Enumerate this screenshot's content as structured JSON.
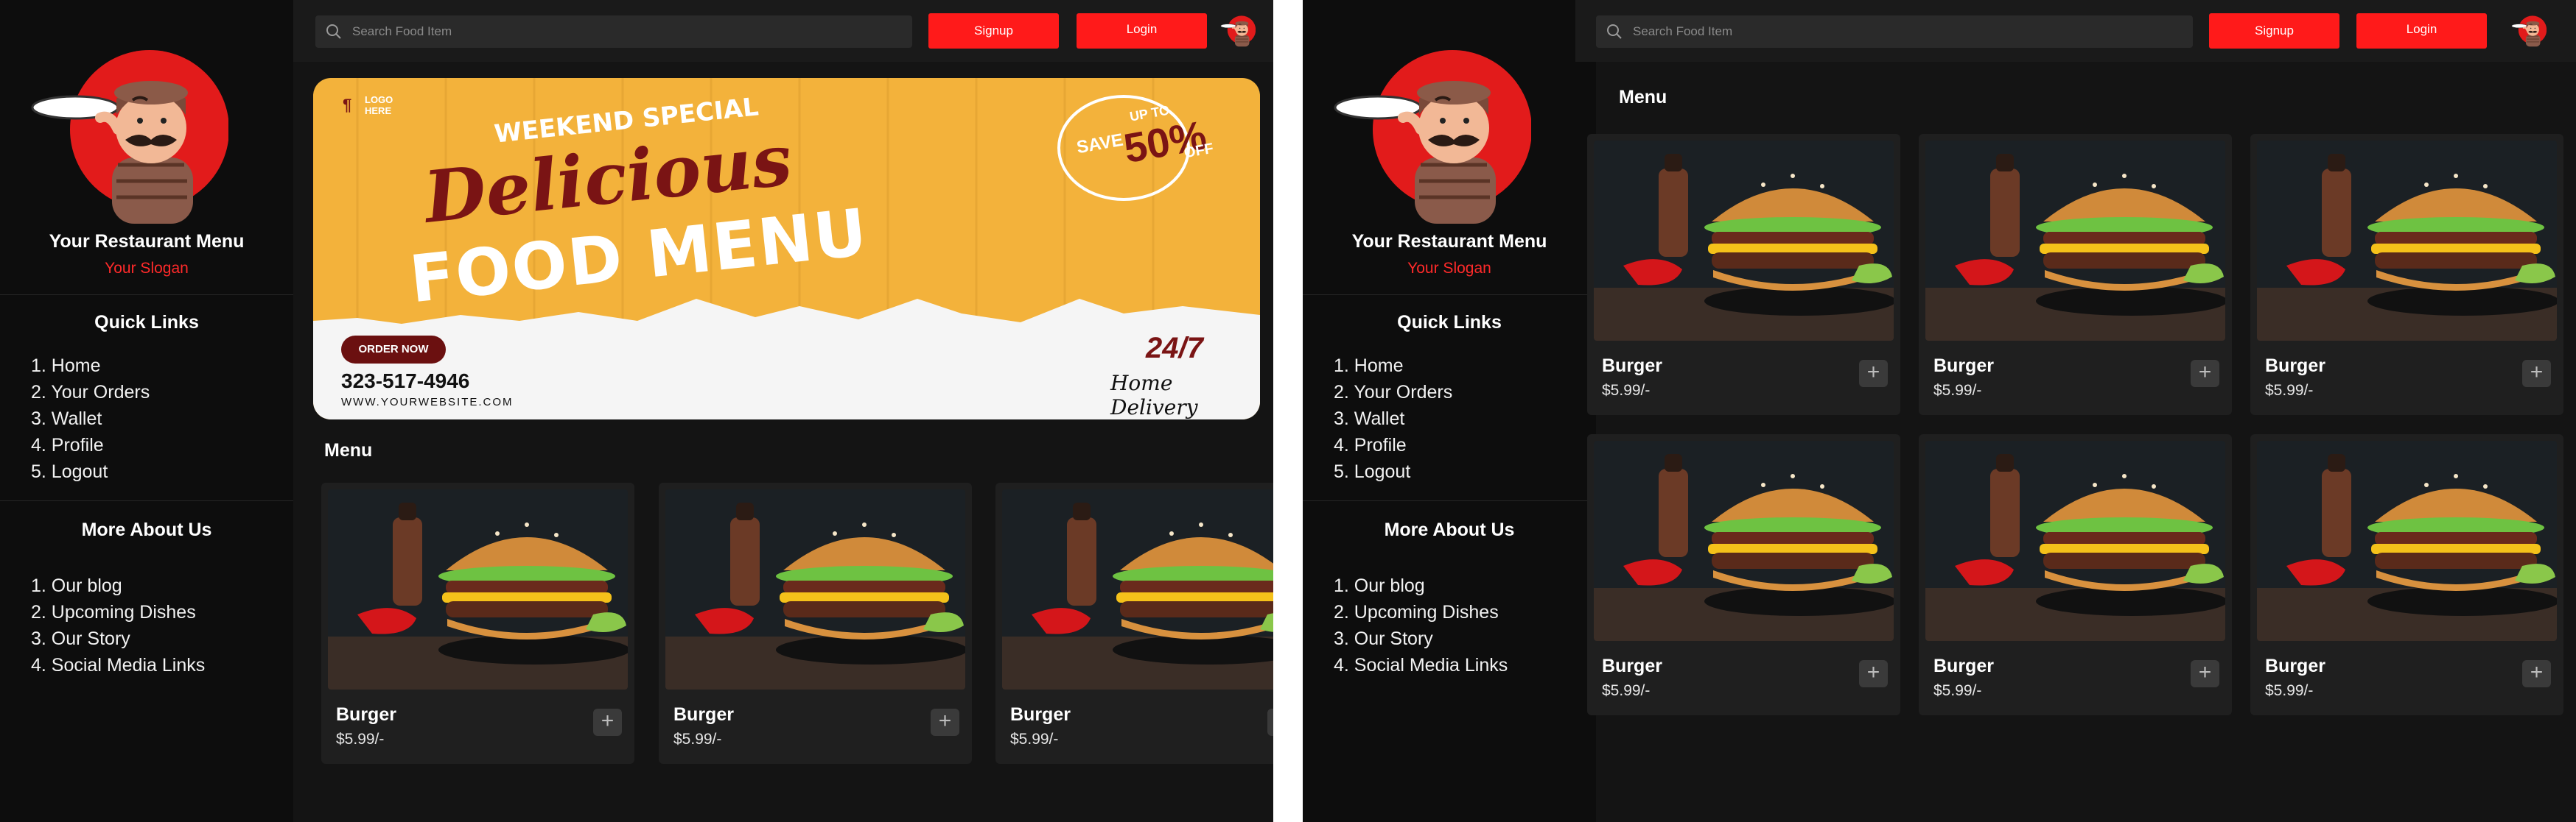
{
  "brand": {
    "name": "Your Restaurant Menu",
    "slogan": "Your Slogan"
  },
  "quick_links": {
    "title": "Quick Links",
    "items": [
      "1. Home",
      "2. Your Orders",
      "3. Wallet",
      "4. Profile",
      "5. Logout"
    ]
  },
  "more_about": {
    "title": "More About Us",
    "items": [
      "1. Our blog",
      "2. Upcoming Dishes",
      "3. Our Story",
      "4. Social Media Links"
    ]
  },
  "search": {
    "placeholder": "Search Food Item"
  },
  "buttons": {
    "signup": "Signup",
    "login": "Login"
  },
  "banner": {
    "logo_line1": "LOGO",
    "logo_line2": "HERE",
    "tag": "WEEKEND SPECIAL",
    "headline1": "Delicious",
    "headline2": "FOOD MENU",
    "save": "SAVE",
    "up_to": "UP TO",
    "percent": "50%",
    "off": "OFF",
    "order_now": "ORDER NOW",
    "phone": "323-517-4946",
    "website": "WWW.YOURWEBSITE.COM",
    "hours": "24/7",
    "delivery": "Home Delivery"
  },
  "menu_title": "Menu",
  "products": [
    {
      "name": "Burger",
      "price": "$5.99/-"
    },
    {
      "name": "Burger",
      "price": "$5.99/-"
    },
    {
      "name": "Burger",
      "price": "$5.99/-"
    },
    {
      "name": "Burger",
      "price": "$5.99/-"
    },
    {
      "name": "Burger",
      "price": "$5.99/-"
    },
    {
      "name": "Burger",
      "price": "$5.99/-"
    }
  ],
  "colors": {
    "accent": "#ff1a1a",
    "background": "#141414",
    "sidebar": "#0d0d0d",
    "card": "#1f1f1f",
    "banner": "#f3b23b"
  }
}
